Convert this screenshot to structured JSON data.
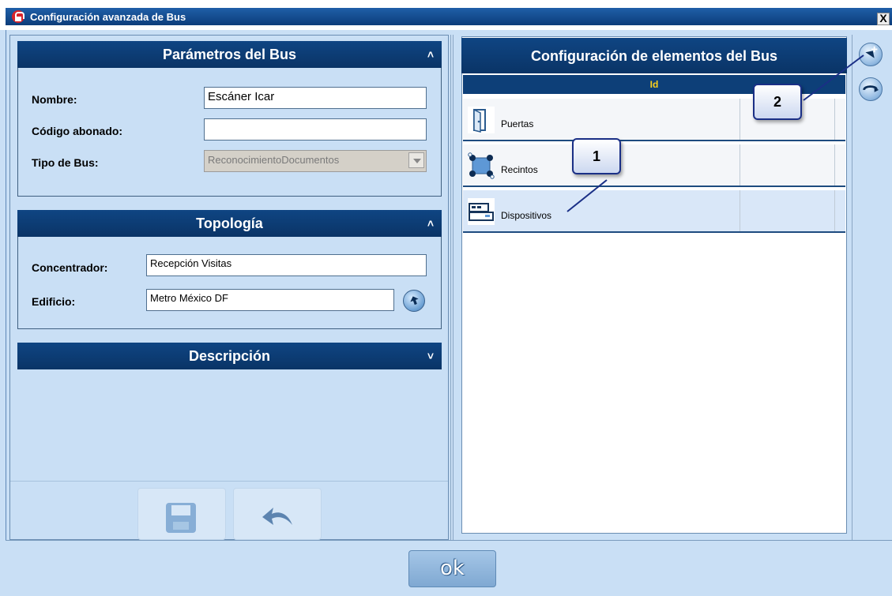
{
  "window": {
    "title": "Configuración avanzada de Bus",
    "close_label": "X"
  },
  "params": {
    "header": "Parámetros del Bus",
    "collapse_icon": "chevron-up-double-icon",
    "nombre_label": "Nombre:",
    "nombre_value": "Escáner Icar",
    "codigo_label": "Código abonado:",
    "codigo_value": "",
    "tipo_label": "Tipo de Bus:",
    "tipo_value": "ReconocimientoDocumentos"
  },
  "topologia": {
    "header": "Topología",
    "concentrador_label": "Concentrador:",
    "concentrador_value": "Recepción Visitas",
    "edificio_label": "Edificio:",
    "edificio_value": "Metro México DF"
  },
  "descripcion": {
    "header": "Descripción"
  },
  "elements": {
    "header": "Configuración de elementos del Bus",
    "column_id": "Id",
    "rows": [
      {
        "label": "Puertas",
        "icon": "door-icon"
      },
      {
        "label": "Recintos",
        "icon": "network-icon"
      },
      {
        "label": "Dispositivos",
        "icon": "device-icon"
      }
    ]
  },
  "callouts": {
    "one": "1",
    "two": "2"
  },
  "footer": {
    "ok_label": "ok"
  },
  "colors": {
    "header_blue": "#0f4583",
    "panel_bg": "#c9dff5",
    "grid_header_text": "#ffd21b",
    "callout_border": "#1a2f86"
  }
}
